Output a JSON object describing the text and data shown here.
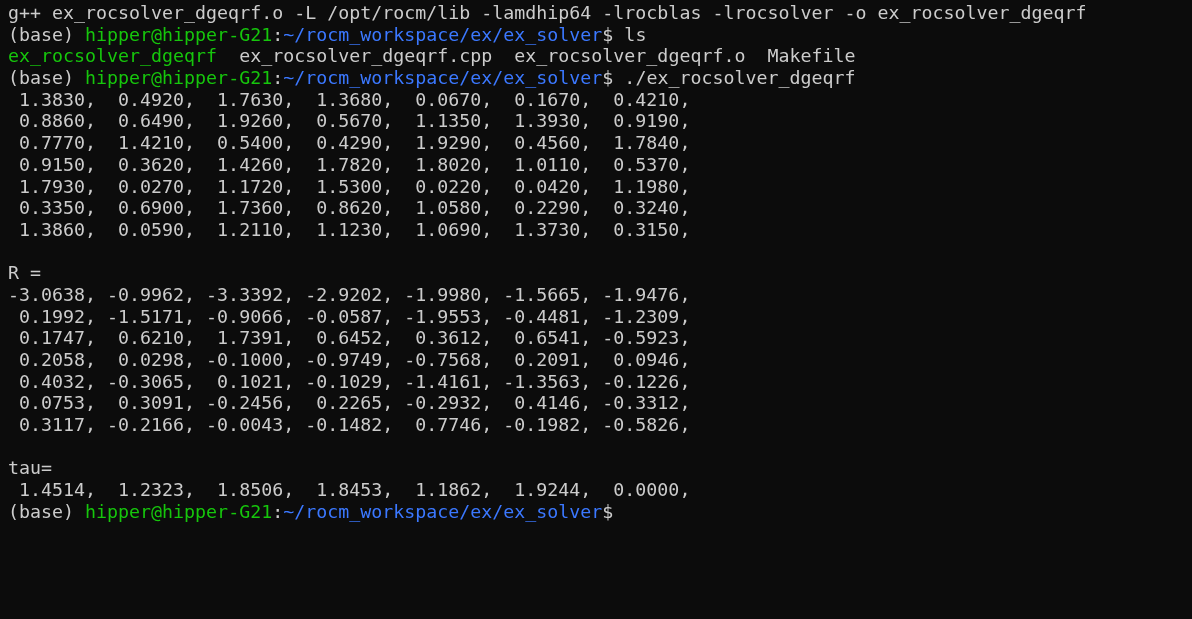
{
  "terminal": {
    "blocks": [
      {
        "lines": [
          {
            "segments": [
              {
                "kind": "text",
                "text": "g++ ex_rocsolver_dgeqrf.o -L /opt/rocm/lib -lamdhip64 -lrocblas -lrocsolver -o ex_rocsolver_dgeqrf"
              }
            ]
          },
          {
            "segments": [
              {
                "kind": "text",
                "text": "(base) "
              },
              {
                "kind": "user",
                "text": "hipper@hipper-G21"
              },
              {
                "kind": "text",
                "text": ":"
              },
              {
                "kind": "path",
                "text": "~/rocm_workspace/ex/ex_solver"
              },
              {
                "kind": "text",
                "text": "$ ls"
              }
            ]
          },
          {
            "segments": [
              {
                "kind": "exe",
                "text": "ex_rocsolver_dgeqrf"
              },
              {
                "kind": "text",
                "text": "  ex_rocsolver_dgeqrf.cpp"
              },
              {
                "kind": "text",
                "text": "  ex_rocsolver_dgeqrf.o"
              },
              {
                "kind": "text",
                "text": "  Makefile"
              }
            ]
          },
          {
            "segments": [
              {
                "kind": "text",
                "text": "(base) "
              },
              {
                "kind": "user",
                "text": "hipper@hipper-G21"
              },
              {
                "kind": "text",
                "text": ":"
              },
              {
                "kind": "path",
                "text": "~/rocm_workspace/ex/ex_solver"
              },
              {
                "kind": "text",
                "text": "$ ./ex_rocsolver_dgeqrf"
              }
            ]
          },
          {
            "segments": [
              {
                "kind": "text",
                "text": " 1.3830,  0.4920,  1.7630,  1.3680,  0.0670,  0.1670,  0.4210,"
              }
            ]
          },
          {
            "segments": [
              {
                "kind": "text",
                "text": " 0.8860,  0.6490,  1.9260,  0.5670,  1.1350,  1.3930,  0.9190,"
              }
            ]
          },
          {
            "segments": [
              {
                "kind": "text",
                "text": " 0.7770,  1.4210,  0.5400,  0.4290,  1.9290,  0.4560,  1.7840,"
              }
            ]
          },
          {
            "segments": [
              {
                "kind": "text",
                "text": " 0.9150,  0.3620,  1.4260,  1.7820,  1.8020,  1.0110,  0.5370,"
              }
            ]
          },
          {
            "segments": [
              {
                "kind": "text",
                "text": " 1.7930,  0.0270,  1.1720,  1.5300,  0.0220,  0.0420,  1.1980,"
              }
            ]
          },
          {
            "segments": [
              {
                "kind": "text",
                "text": " 0.3350,  0.6900,  1.7360,  0.8620,  1.0580,  0.2290,  0.3240,"
              }
            ]
          },
          {
            "segments": [
              {
                "kind": "text",
                "text": " 1.3860,  0.0590,  1.2110,  1.1230,  1.0690,  1.3730,  0.3150,"
              }
            ]
          }
        ]
      },
      {
        "lines": [
          {
            "segments": [
              {
                "kind": "text",
                "text": "R ="
              }
            ]
          },
          {
            "segments": [
              {
                "kind": "text",
                "text": "-3.0638, -0.9962, -3.3392, -2.9202, -1.9980, -1.5665, -1.9476,"
              }
            ]
          },
          {
            "segments": [
              {
                "kind": "text",
                "text": " 0.1992, -1.5171, -0.9066, -0.0587, -1.9553, -0.4481, -1.2309,"
              }
            ]
          },
          {
            "segments": [
              {
                "kind": "text",
                "text": " 0.1747,  0.6210,  1.7391,  0.6452,  0.3612,  0.6541, -0.5923,"
              }
            ]
          },
          {
            "segments": [
              {
                "kind": "text",
                "text": " 0.2058,  0.0298, -0.1000, -0.9749, -0.7568,  0.2091,  0.0946,"
              }
            ]
          },
          {
            "segments": [
              {
                "kind": "text",
                "text": " 0.4032, -0.3065,  0.1021, -0.1029, -1.4161, -1.3563, -0.1226,"
              }
            ]
          },
          {
            "segments": [
              {
                "kind": "text",
                "text": " 0.0753,  0.3091, -0.2456,  0.2265, -0.2932,  0.4146, -0.3312,"
              }
            ]
          },
          {
            "segments": [
              {
                "kind": "text",
                "text": " 0.3117, -0.2166, -0.0043, -0.1482,  0.7746, -0.1982, -0.5826,"
              }
            ]
          }
        ]
      },
      {
        "lines": [
          {
            "segments": [
              {
                "kind": "text",
                "text": "tau="
              }
            ]
          },
          {
            "segments": [
              {
                "kind": "text",
                "text": " 1.4514,  1.2323,  1.8506,  1.8453,  1.1862,  1.9244,  0.0000,"
              }
            ]
          },
          {
            "segments": [
              {
                "kind": "text",
                "text": "(base) "
              },
              {
                "kind": "user",
                "text": "hipper@hipper-G21"
              },
              {
                "kind": "text",
                "text": ":"
              },
              {
                "kind": "path",
                "text": "~/rocm_workspace/ex/ex_solver"
              },
              {
                "kind": "text",
                "text": "$"
              }
            ]
          }
        ]
      }
    ]
  }
}
